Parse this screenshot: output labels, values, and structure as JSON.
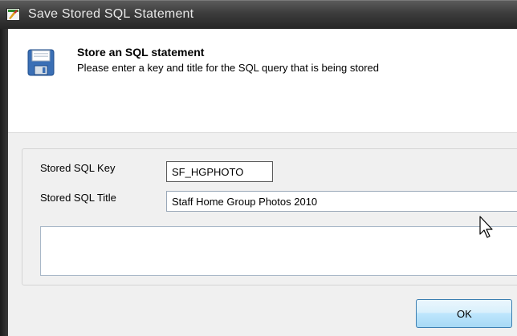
{
  "window": {
    "title": "Save Stored SQL Statement",
    "app_icon": "sql-app-icon"
  },
  "header": {
    "icon": "save-floppy-icon",
    "title": "Store an SQL statement",
    "description": "Please enter a key and title for the SQL query that is being stored"
  },
  "form": {
    "key_label": "Stored SQL Key",
    "key_value": "SF_HGPHOTO",
    "title_label": "Stored SQL Title",
    "title_value": "Staff Home Group Photos 2010",
    "description_value": ""
  },
  "buttons": {
    "ok_label": "OK"
  },
  "colors": {
    "titlebar": "#3c3c3c",
    "body_background": "#f0f0f0",
    "button_border": "#3c7fb1"
  }
}
